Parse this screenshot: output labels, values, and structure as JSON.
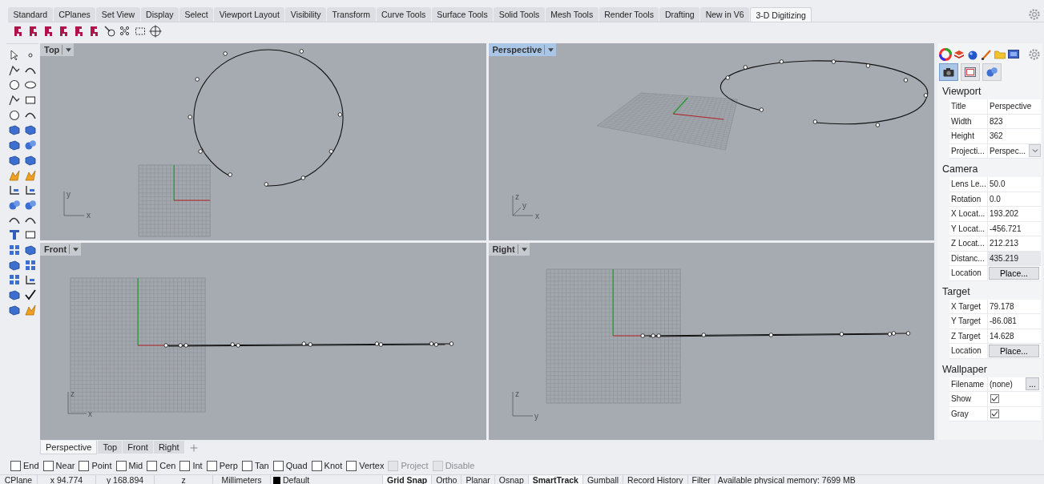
{
  "ribbon_tabs": [
    {
      "label": "Standard",
      "selected": false
    },
    {
      "label": "CPlanes",
      "selected": false
    },
    {
      "label": "Set View",
      "selected": false
    },
    {
      "label": "Display",
      "selected": false
    },
    {
      "label": "Select",
      "selected": false
    },
    {
      "label": "Viewport Layout",
      "selected": false
    },
    {
      "label": "Visibility",
      "selected": false
    },
    {
      "label": "Transform",
      "selected": false
    },
    {
      "label": "Curve Tools",
      "selected": false
    },
    {
      "label": "Surface Tools",
      "selected": false
    },
    {
      "label": "Solid Tools",
      "selected": false
    },
    {
      "label": "Mesh Tools",
      "selected": false
    },
    {
      "label": "Render Tools",
      "selected": false
    },
    {
      "label": "Drafting",
      "selected": false
    },
    {
      "label": "New in V6",
      "selected": false
    },
    {
      "label": "3-D Digitizing",
      "selected": true
    }
  ],
  "viewports": [
    {
      "kind": "top",
      "title": "Top",
      "active": false,
      "axis_labels": [
        "y",
        "x"
      ]
    },
    {
      "kind": "perspective",
      "title": "Perspective",
      "active": true,
      "axis_labels": [
        "z",
        "y",
        "x"
      ]
    },
    {
      "kind": "front",
      "title": "Front",
      "active": false,
      "axis_labels": [
        "z",
        "x"
      ]
    },
    {
      "kind": "right",
      "title": "Right",
      "active": false,
      "axis_labels": [
        "z",
        "y"
      ]
    }
  ],
  "viewport_tabs": [
    {
      "label": "Perspective",
      "selected": true
    },
    {
      "label": "Top",
      "selected": false
    },
    {
      "label": "Front",
      "selected": false
    },
    {
      "label": "Right",
      "selected": false
    }
  ],
  "panel": {
    "buttons": [
      {
        "kind": "camera",
        "selected": true
      },
      {
        "kind": "frame",
        "selected": false
      },
      {
        "kind": "spheres",
        "selected": false
      }
    ],
    "sections": [
      {
        "title": "Viewport",
        "rows": [
          {
            "kind": "text",
            "label": "Title",
            "value": "Perspective"
          },
          {
            "kind": "text",
            "label": "Width",
            "value": "823"
          },
          {
            "kind": "text",
            "label": "Height",
            "value": "362"
          },
          {
            "kind": "dropdown",
            "label": "Projecti...",
            "value": "Perspec..."
          }
        ]
      },
      {
        "title": "Camera",
        "rows": [
          {
            "kind": "text",
            "label": "Lens Le...",
            "value": "50.0"
          },
          {
            "kind": "text",
            "label": "Rotation",
            "value": "0.0"
          },
          {
            "kind": "text",
            "label": "X Locat...",
            "value": "193.202"
          },
          {
            "kind": "text",
            "label": "Y Locat...",
            "value": "-456.721"
          },
          {
            "kind": "text",
            "label": "Z Locat...",
            "value": "212.213"
          },
          {
            "kind": "readonly",
            "label": "Distanc...",
            "value": "435.219"
          },
          {
            "kind": "button",
            "label": "Location",
            "value": "Place..."
          }
        ]
      },
      {
        "title": "Target",
        "rows": [
          {
            "kind": "text",
            "label": "X Target",
            "value": "79.178"
          },
          {
            "kind": "text",
            "label": "Y Target",
            "value": "-86.081"
          },
          {
            "kind": "text",
            "label": "Z Target",
            "value": "14.628"
          },
          {
            "kind": "button",
            "label": "Location",
            "value": "Place..."
          }
        ]
      },
      {
        "title": "Wallpaper",
        "rows": [
          {
            "kind": "file",
            "label": "Filename",
            "value": "(none)",
            "button_label": "..."
          },
          {
            "kind": "checkbox",
            "label": "Show",
            "checked": true
          },
          {
            "kind": "checkbox",
            "label": "Gray",
            "checked": true
          }
        ]
      }
    ]
  },
  "osnaps": [
    {
      "label": "End",
      "checked": false,
      "disabled": false
    },
    {
      "label": "Near",
      "checked": false,
      "disabled": false
    },
    {
      "label": "Point",
      "checked": false,
      "disabled": false
    },
    {
      "label": "Mid",
      "checked": false,
      "disabled": false
    },
    {
      "label": "Cen",
      "checked": false,
      "disabled": false
    },
    {
      "label": "Int",
      "checked": false,
      "disabled": false
    },
    {
      "label": "Perp",
      "checked": false,
      "disabled": false
    },
    {
      "label": "Tan",
      "checked": false,
      "disabled": false
    },
    {
      "label": "Quad",
      "checked": false,
      "disabled": false
    },
    {
      "label": "Knot",
      "checked": false,
      "disabled": false
    },
    {
      "label": "Vertex",
      "checked": false,
      "disabled": false
    },
    {
      "label": "Project",
      "checked": false,
      "disabled": true
    },
    {
      "label": "Disable",
      "checked": false,
      "disabled": true
    }
  ],
  "status_bar": {
    "cplane": "CPlane",
    "x": "x 94.774",
    "y": "y 168.894",
    "z": "z",
    "units": "Millimeters",
    "layer": {
      "name": "Default",
      "color": "#000000"
    },
    "toggles": [
      {
        "label": "Grid Snap",
        "on": true
      },
      {
        "label": "Ortho",
        "on": false
      },
      {
        "label": "Planar",
        "on": false
      },
      {
        "label": "Osnap",
        "on": false
      },
      {
        "label": "SmartTrack",
        "on": true
      },
      {
        "label": "Gumball",
        "on": false
      },
      {
        "label": "Record History",
        "on": false
      },
      {
        "label": "Filter",
        "on": false
      }
    ],
    "memory": "Available physical memory: 7699 MB"
  }
}
